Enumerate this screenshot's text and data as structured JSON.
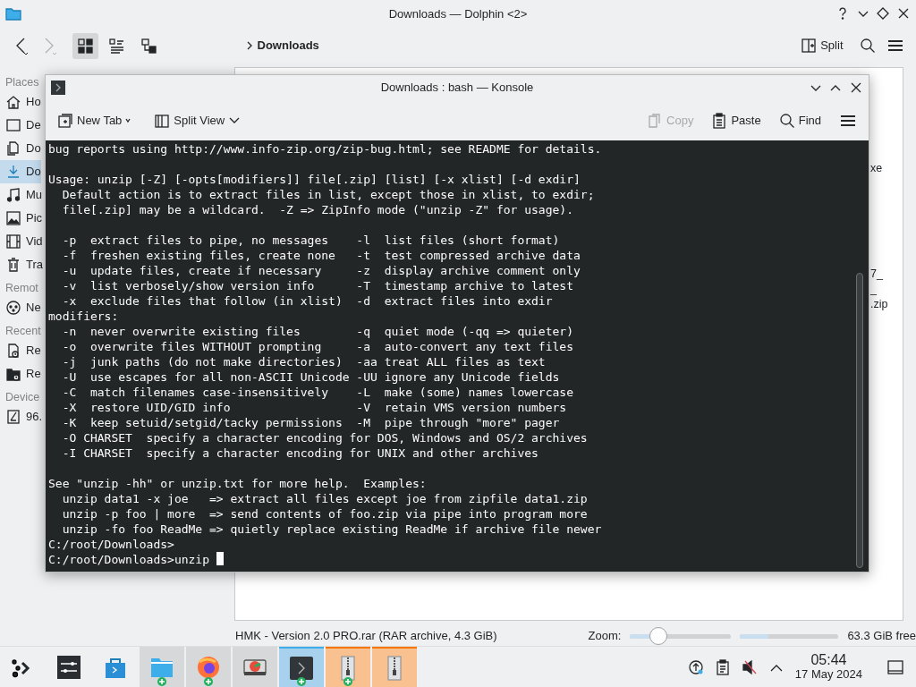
{
  "dolphin": {
    "title": "Downloads — Dolphin <2>",
    "nav": [
      {
        "disabled": false
      },
      {
        "disabled": true
      }
    ],
    "view_modes": [
      {
        "selected": true
      },
      {
        "selected": false
      },
      {
        "selected": false
      }
    ],
    "breadcrumb": "Downloads",
    "split_label": "Split"
  },
  "sidebar": {
    "sections": [
      {
        "heading": "Places",
        "items": [
          {
            "label": "Ho",
            "selected": false
          },
          {
            "label": "De",
            "selected": false
          },
          {
            "label": "Do",
            "selected": false
          },
          {
            "label": "Do",
            "selected": true
          },
          {
            "label": "Mu",
            "selected": false
          },
          {
            "label": "Pic",
            "selected": false
          },
          {
            "label": "Vid",
            "selected": false
          },
          {
            "label": "Tra",
            "selected": false
          }
        ]
      },
      {
        "heading": "Remot",
        "items": [
          {
            "label": "Ne",
            "selected": false
          }
        ]
      },
      {
        "heading": "Recent",
        "items": [
          {
            "label": "Re",
            "selected": false
          },
          {
            "label": "Re",
            "selected": false
          }
        ]
      },
      {
        "heading": "Device",
        "items": [
          {
            "label": "96.",
            "selected": false
          }
        ]
      }
    ]
  },
  "file_fragments": [
    "xe",
    "7_",
    "_",
    ".zip"
  ],
  "status_bar": {
    "text": "HMK - Version 2.0 PRO.rar (RAR archive, 4.3 GiB)",
    "zoom_label": "Zoom:",
    "zoom_slider": {
      "level": 0.28
    },
    "free_space": {
      "level": 0.29,
      "text": "63.3 GiB free"
    }
  },
  "konsole": {
    "title": "Downloads : bash — Konsole",
    "toolbar": [
      {
        "label": "New Tab",
        "disabled": false
      },
      {
        "label": "Split View",
        "disabled": false
      },
      {
        "label": "Copy",
        "disabled": true
      },
      {
        "label": "Paste",
        "disabled": false
      },
      {
        "label": "Find",
        "disabled": false
      }
    ],
    "terminal": {
      "blocks": [
        [
          "bug reports using http://www.info-zip.org/zip-bug.html; see README for details."
        ],
        [
          "Usage: unzip [-Z] [-opts[modifiers]] file[.zip] [list] [-x xlist] [-d exdir]",
          "  Default action is to extract files in list, except those in xlist, to exdir;",
          "  file[.zip] may be a wildcard.  -Z => ZipInfo mode (\"unzip -Z\" for usage)."
        ],
        [
          "  -p  extract files to pipe, no messages    -l  list files (short format)",
          "  -f  freshen existing files, create none   -t  test compressed archive data",
          "  -u  update files, create if necessary     -z  display archive comment only",
          "  -v  list verbosely/show version info      -T  timestamp archive to latest",
          "  -x  exclude files that follow (in xlist)  -d  extract files into exdir",
          "modifiers:",
          "  -n  never overwrite existing files        -q  quiet mode (-qq => quieter)",
          "  -o  overwrite files WITHOUT prompting     -a  auto-convert any text files",
          "  -j  junk paths (do not make directories)  -aa treat ALL files as text",
          "  -U  use escapes for all non-ASCII Unicode -UU ignore any Unicode fields",
          "  -C  match filenames case-insensitively    -L  make (some) names lowercase",
          "  -X  restore UID/GID info                  -V  retain VMS version numbers",
          "  -K  keep setuid/setgid/tacky permissions  -M  pipe through \"more\" pager",
          "  -O CHARSET  specify a character encoding for DOS, Windows and OS/2 archives",
          "  -I CHARSET  specify a character encoding for UNIX and other archives"
        ],
        [
          "See \"unzip -hh\" or unzip.txt for more help.  Examples:",
          "  unzip data1 -x joe   => extract all files except joe from zipfile data1.zip",
          "  unzip -p foo | more  => send contents of foo.zip via pipe into program more",
          "  unzip -fo foo ReadMe => quietly replace existing ReadMe if archive file newer",
          "C:/root/Downloads>",
          "C:/root/Downloads>unzip"
        ]
      ],
      "cursor": true
    }
  },
  "taskbar": {
    "items": [
      {
        "running": false,
        "active": false,
        "attention": false,
        "badge": false
      },
      {
        "running": false,
        "active": false,
        "attention": false,
        "badge": false
      },
      {
        "running": false,
        "active": false,
        "attention": false,
        "badge": false
      },
      {
        "running": true,
        "active": false,
        "attention": false,
        "badge": true
      },
      {
        "running": true,
        "active": false,
        "attention": false,
        "badge": true
      },
      {
        "running": true,
        "active": false,
        "attention": false,
        "badge": false
      },
      {
        "running": true,
        "active": true,
        "attention": false,
        "badge": true
      },
      {
        "running": true,
        "active": false,
        "attention": true,
        "badge": true
      },
      {
        "running": true,
        "active": false,
        "attention": true,
        "badge": false
      }
    ],
    "clock": "05:44",
    "date": "17 May 2024"
  }
}
